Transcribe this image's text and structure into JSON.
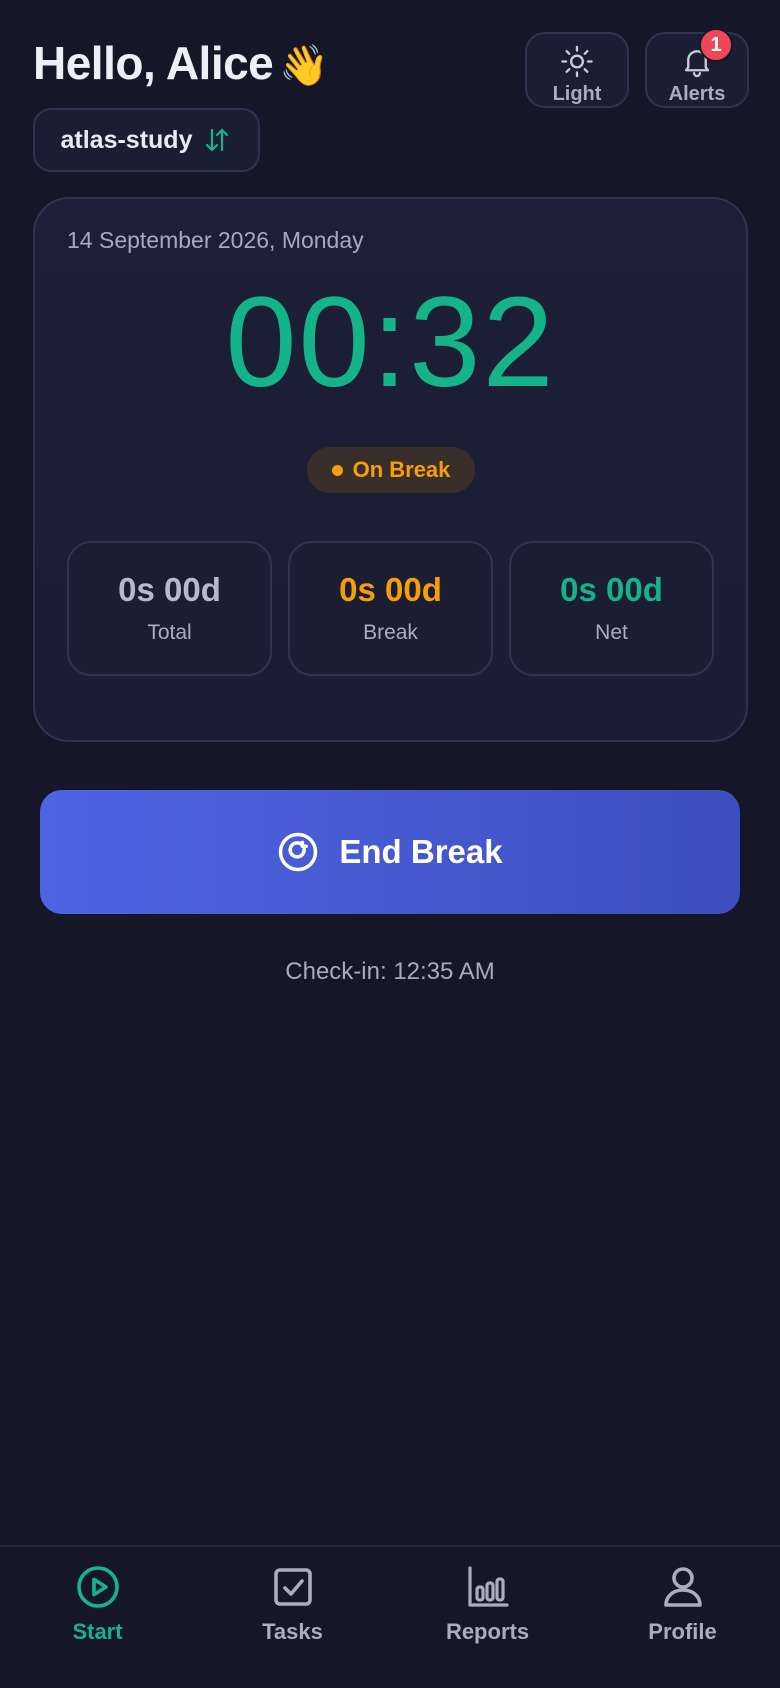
{
  "header": {
    "greeting": "Hello, Alice",
    "wave_emoji": "👋",
    "light_label": "Light",
    "alerts_label": "Alerts",
    "alerts_count": "1"
  },
  "project": {
    "name": "atlas-study",
    "switch_icon": "swap-vertical-icon"
  },
  "timer_card": {
    "date": "14 September 2026, Monday",
    "time": "00:32",
    "status": "On Break",
    "stats": {
      "total": {
        "value": "0s 00d",
        "label": "Total"
      },
      "break": {
        "value": "0s 00d",
        "label": "Break"
      },
      "net": {
        "value": "0s 00d",
        "label": "Net"
      }
    }
  },
  "action": {
    "label": "End Break",
    "icon": "refresh-circle-icon"
  },
  "checkin": "Check-in: 12:35 AM",
  "nav": {
    "start": "Start",
    "tasks": "Tasks",
    "reports": "Reports",
    "profile": "Profile",
    "active": "start"
  },
  "colors": {
    "background": "#151728",
    "accent_green": "#14b38a",
    "accent_orange": "#f59e0b",
    "primary_button": "#4f64e2",
    "badge_red": "#ef4758"
  }
}
